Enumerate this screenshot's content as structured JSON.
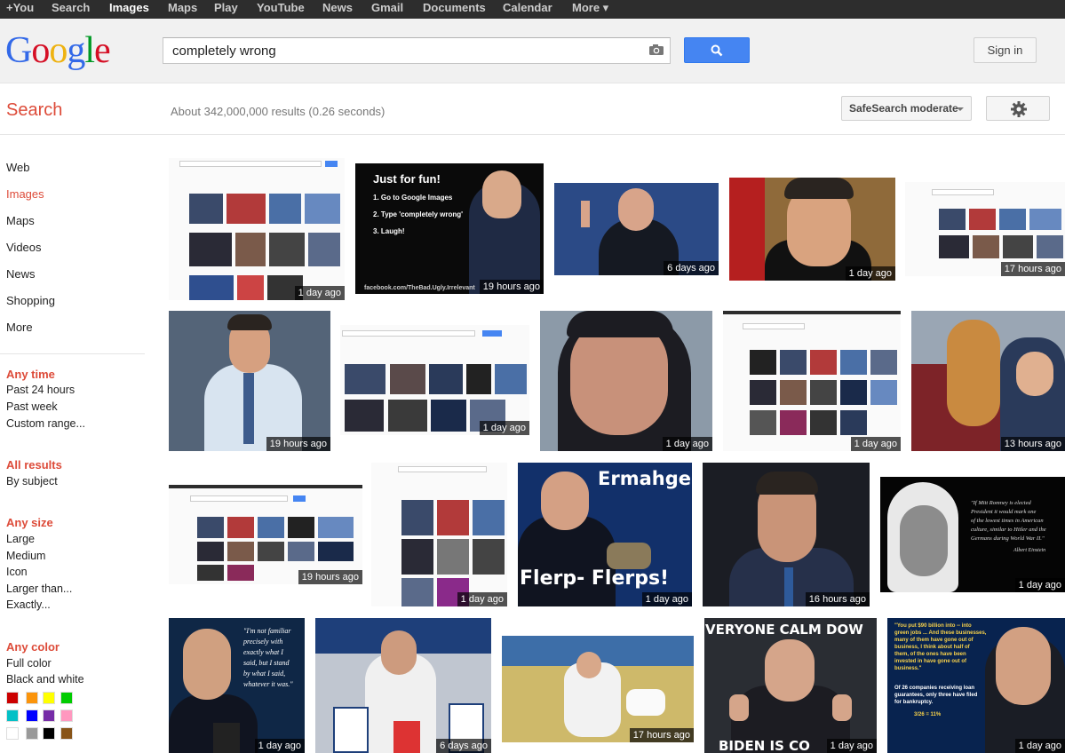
{
  "topbar": {
    "items": [
      "+You",
      "Search",
      "Images",
      "Maps",
      "Play",
      "YouTube",
      "News",
      "Gmail",
      "Documents",
      "Calendar",
      "More ▾"
    ],
    "active": "Images"
  },
  "header": {
    "logo_letters": [
      "G",
      "o",
      "o",
      "g",
      "l",
      "e"
    ],
    "logo_colors": [
      "#3369e8",
      "#d50f25",
      "#eeb211",
      "#3369e8",
      "#009925",
      "#d50f25"
    ],
    "query": "completely wrong",
    "camera_icon": "camera-icon",
    "search_icon": "search-icon",
    "signin_label": "Sign in"
  },
  "subheader": {
    "search_label": "Search",
    "result_stats": "About 342,000,000 results (0.26 seconds)",
    "safesearch_label": "SafeSearch moderate",
    "gear_icon": "gear-icon"
  },
  "leftnav": {
    "types": [
      "Web",
      "Images",
      "Maps",
      "Videos",
      "News",
      "Shopping",
      "More"
    ],
    "selected_type": "Images",
    "time": {
      "head": "Any time",
      "options": [
        "Past 24 hours",
        "Past week",
        "Custom range..."
      ]
    },
    "results": {
      "head": "All results",
      "options": [
        "By subject"
      ]
    },
    "size": {
      "head": "Any size",
      "options": [
        "Large",
        "Medium",
        "Icon",
        "Larger than...",
        "Exactly..."
      ]
    },
    "color": {
      "head": "Any color",
      "options": [
        "Full color",
        "Black and white"
      ]
    },
    "swatches": [
      "#cc0000",
      "#fb940b",
      "#ffff00",
      "#00cc00",
      "#03c0c6",
      "#0000ff",
      "#762ca7",
      "#ff98bf",
      "#ffffff",
      "#999999",
      "#000000",
      "#885418"
    ],
    "accent": "#dd4b39"
  },
  "results": [
    {
      "kind": "screenshot",
      "timestamp": "1 day ago"
    },
    {
      "kind": "meme",
      "timestamp": "19 hours ago",
      "caption_lines": [
        "Just for fun!",
        "1. Go to Google Images",
        "2. Type 'completely wrong'",
        "3. Laugh!"
      ],
      "footer": "facebook.com/TheBad.Ugly.Irrelevant"
    },
    {
      "kind": "photo",
      "timestamp": "6 days ago"
    },
    {
      "kind": "photo",
      "timestamp": "1 day ago"
    },
    {
      "kind": "screenshot",
      "timestamp": "17 hours ago"
    },
    {
      "kind": "photo",
      "timestamp": "19 hours ago"
    },
    {
      "kind": "screenshot",
      "timestamp": "1 day ago"
    },
    {
      "kind": "photo",
      "timestamp": "1 day ago"
    },
    {
      "kind": "screenshot",
      "timestamp": "1 day ago"
    },
    {
      "kind": "photo",
      "timestamp": "13 hours ago"
    },
    {
      "kind": "screenshot",
      "timestamp": "19 hours ago"
    },
    {
      "kind": "screenshot",
      "timestamp": "1 day ago"
    },
    {
      "kind": "meme",
      "timestamp": "1 day ago",
      "caption_lines": [
        "Ermahgerd",
        "Flerp- Flerps!"
      ]
    },
    {
      "kind": "photo",
      "timestamp": "16 hours ago"
    },
    {
      "kind": "quote",
      "timestamp": "1 day ago",
      "caption_lines": [
        "\"If Mitt Romney is elected",
        "President it would mark one",
        "of the lowest times in American",
        "culture, similar to Hitler and the",
        "Germans during World War II.\"",
        "Albert Einstein"
      ]
    },
    {
      "kind": "quote",
      "timestamp": "1 day ago",
      "caption_lines": [
        "\"I'm not familiar",
        "precisely with",
        "exactly what I",
        "said, but I stand",
        "by what I said,",
        "whatever it was.\""
      ]
    },
    {
      "kind": "photo",
      "timestamp": "6 days ago"
    },
    {
      "kind": "photo",
      "timestamp": "17 hours ago"
    },
    {
      "kind": "meme",
      "timestamp": "1 day ago",
      "caption_lines": [
        "VERYONE CALM DOW",
        "BIDEN IS CO"
      ]
    },
    {
      "kind": "quote",
      "timestamp": "1 day ago",
      "caption_lines": [
        "\"You put $90 billion into -- into",
        "green jobs ... And these businesses,",
        "many of them have gone out of",
        "business, I think about half of",
        "them, of the ones have been",
        "invested in have gone out of",
        "business.\"",
        "Of 26 companies receiving loan",
        "guarantees, only three have filed",
        "for bankruptcy.",
        "3/26 = 11%"
      ]
    }
  ]
}
